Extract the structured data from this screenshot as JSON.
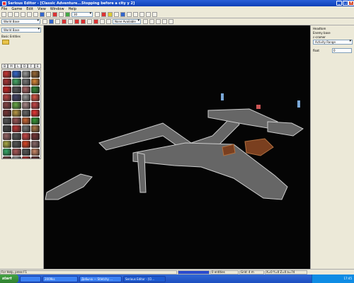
{
  "window": {
    "title": "Serious Editor - [Classic Adventure...Stopping before a city у 2]"
  },
  "menu": [
    "File",
    "Game",
    "Edit",
    "View",
    "Window",
    "Help"
  ],
  "toolbar": {
    "zoom_value": "30",
    "mode_value": "None Available"
  },
  "left_panel": {
    "world_combo": "World Base",
    "browser_title": "Basic Entities",
    "folder_label": "",
    "tabs": [
      "B",
      "M",
      "L",
      "D",
      "F",
      "E"
    ],
    "thumb_colors": [
      "#c33",
      "#36c",
      "#999",
      "#963",
      "#a33",
      "#4a6",
      "#777",
      "#d83",
      "#c22",
      "#555",
      "#a66",
      "#383",
      "#b44",
      "#446",
      "#999",
      "#d54",
      "#844",
      "#6a4",
      "#a88",
      "#c44",
      "#733",
      "#b94",
      "#666",
      "#e33",
      "#555",
      "#955",
      "#c63",
      "#393",
      "#444",
      "#b33",
      "#777",
      "#a74",
      "#966",
      "#555",
      "#c44",
      "#733",
      "#aa4",
      "#555",
      "#d42",
      "#866",
      "#3a6",
      "#a55",
      "#555",
      "#c86",
      "#744",
      "#999",
      "#b33",
      "#633"
    ]
  },
  "right_panel": {
    "line1": "Headtom",
    "line2": "Enemy base",
    "line3": "c-cramer",
    "combo": "Activity Range",
    "float_label": "float",
    "float_value": "0"
  },
  "status": {
    "help": "For Help, press F1",
    "entities": "0 entities",
    "grid": "Grid: 4 m",
    "coords": "X=0 Y=0 Z=0 a=74"
  },
  "taskbar": {
    "start": "start",
    "items": [
      "",
      "2009ks",
      "Добыча — Stletchy ...",
      "Serious Editor - [Cl..."
    ],
    "clock": "17:45"
  }
}
